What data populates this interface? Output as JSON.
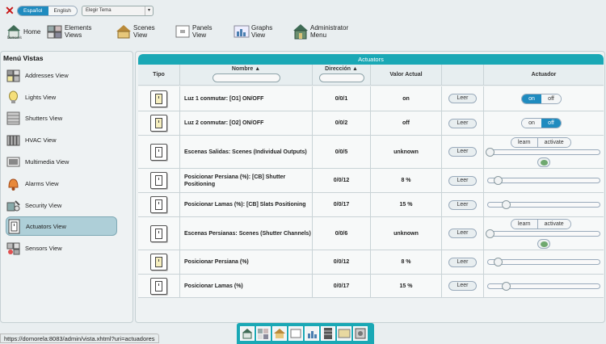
{
  "top": {
    "lang": [
      "Español",
      "English"
    ],
    "theme": "Elegir Tema"
  },
  "nav": [
    "Home",
    "Elements Views",
    "Scenes View",
    "Panels View",
    "Graphs View",
    "Administrator Menu"
  ],
  "sidebar": {
    "title": "Menú Vistas",
    "items": [
      "Addresses View",
      "Lights View",
      "Shutters View",
      "HVAC View",
      "Multimedia View",
      "Alarms View",
      "Security View",
      "Actuators View",
      "Sensors View"
    ]
  },
  "table": {
    "title": "Actuators",
    "headers": {
      "tipo": "Tipo",
      "nombre": "Nombre ▲",
      "direccion": "Dirección ▲",
      "valor": "Valor Actual",
      "actuador": "Actuador"
    },
    "leer": "Leer",
    "on": "on",
    "off": "off",
    "learn": "learn",
    "activate": "activate",
    "rows": [
      {
        "nombre": "Luz 1 conmutar: [O1] ON/OFF",
        "dir": "0/0/1",
        "valor": "on",
        "kind": "toggle",
        "state": "on",
        "switch_on": true
      },
      {
        "nombre": "Luz 2 conmutar: [O2] ON/OFF",
        "dir": "0/0/2",
        "valor": "off",
        "kind": "toggle",
        "state": "off",
        "switch_on": true
      },
      {
        "nombre": "Escenas Salidas: Scenes (Individual Outputs)",
        "dir": "0/0/5",
        "valor": "unknown",
        "kind": "scene",
        "level": 0
      },
      {
        "nombre": "Posicionar Persiana (%): [CB] Shutter Positioning",
        "dir": "0/0/12",
        "valor": "8 %",
        "kind": "slider",
        "level": 0.08
      },
      {
        "nombre": "Posicionar Lamas (%): [CB] Slats Positioning",
        "dir": "0/0/17",
        "valor": "15 %",
        "kind": "slider",
        "level": 0.15
      },
      {
        "nombre": "Escenas Persianas: Scenes (Shutter Channels)",
        "dir": "0/0/6",
        "valor": "unknown",
        "kind": "scene",
        "level": 0
      },
      {
        "nombre": "Posicionar Persiana (%)",
        "dir": "0/0/12",
        "valor": "8 %",
        "kind": "slider",
        "level": 0.08,
        "switch_on": true
      },
      {
        "nombre": "Posicionar Lamas (%)",
        "dir": "0/0/17",
        "valor": "15 %",
        "kind": "slider",
        "level": 0.15
      }
    ]
  },
  "status_url": "https://domorela:8083/admin/vista.xhtml?uri=actuadores",
  "colors": {
    "accent": "#1aa8b5",
    "toggle_on": "#1f8bbf",
    "close": "#c81818"
  }
}
